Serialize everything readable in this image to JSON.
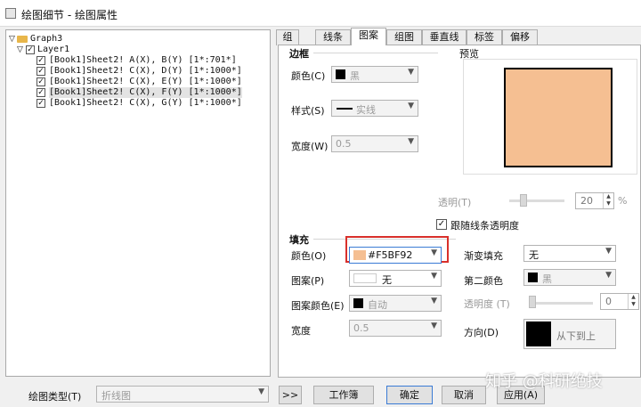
{
  "window": {
    "title": "绘图细节 - 绘图属性"
  },
  "tree": {
    "root": "Graph3",
    "layer": "Layer1",
    "plots": [
      "[Book1]Sheet2! A(X), B(Y) [1*:701*]",
      "[Book1]Sheet2! C(X), D(Y) [1*:1000*]",
      "[Book1]Sheet2! C(X), E(Y) [1*:1000*]",
      "[Book1]Sheet2! C(X), F(Y) [1*:1000*]",
      "[Book1]Sheet2! C(X), G(Y) [1*:1000*]"
    ]
  },
  "tabs": [
    "组",
    "线条",
    "图案",
    "组图",
    "垂直线",
    "标签",
    "偏移"
  ],
  "border": {
    "section": "边框",
    "color_label": "颜色(C)",
    "color_value": "黑",
    "style_label": "样式(S)",
    "style_value": "实线",
    "width_label": "宽度(W)",
    "width_value": "0.5"
  },
  "preview": {
    "label": "预览",
    "fill_color": "#F5BF92"
  },
  "transparency": {
    "label": "透明(T)",
    "value": "20",
    "unit": "%"
  },
  "follow_line": {
    "label": "跟随线条透明度",
    "checked": true
  },
  "fill": {
    "section": "填充",
    "color_label": "颜色(O)",
    "color_value": "#F5BF92",
    "color_hex": "#F5BF92",
    "gradient_label": "渐变填充",
    "gradient_value": "无",
    "pattern_label": "图案(P)",
    "pattern_value": "无",
    "second_color_label": "第二颜色",
    "second_color_value": "黑",
    "pattern_color_label": "图案颜色(E)",
    "pattern_color_value": "自动",
    "opacity_label": "透明度 (T)",
    "opacity_value": "0",
    "width_label": "宽度",
    "width_value": "0.5",
    "direction_label": "方向(D)",
    "direction_value": "从下到上"
  },
  "bottom": {
    "plot_type_label": "绘图类型(T)",
    "plot_type_value": "折线图",
    "expand": ">>",
    "workbook": "工作簿",
    "ok": "确定",
    "cancel": "取消",
    "apply": "应用(A)"
  },
  "watermark": "知乎 @科研绝技"
}
